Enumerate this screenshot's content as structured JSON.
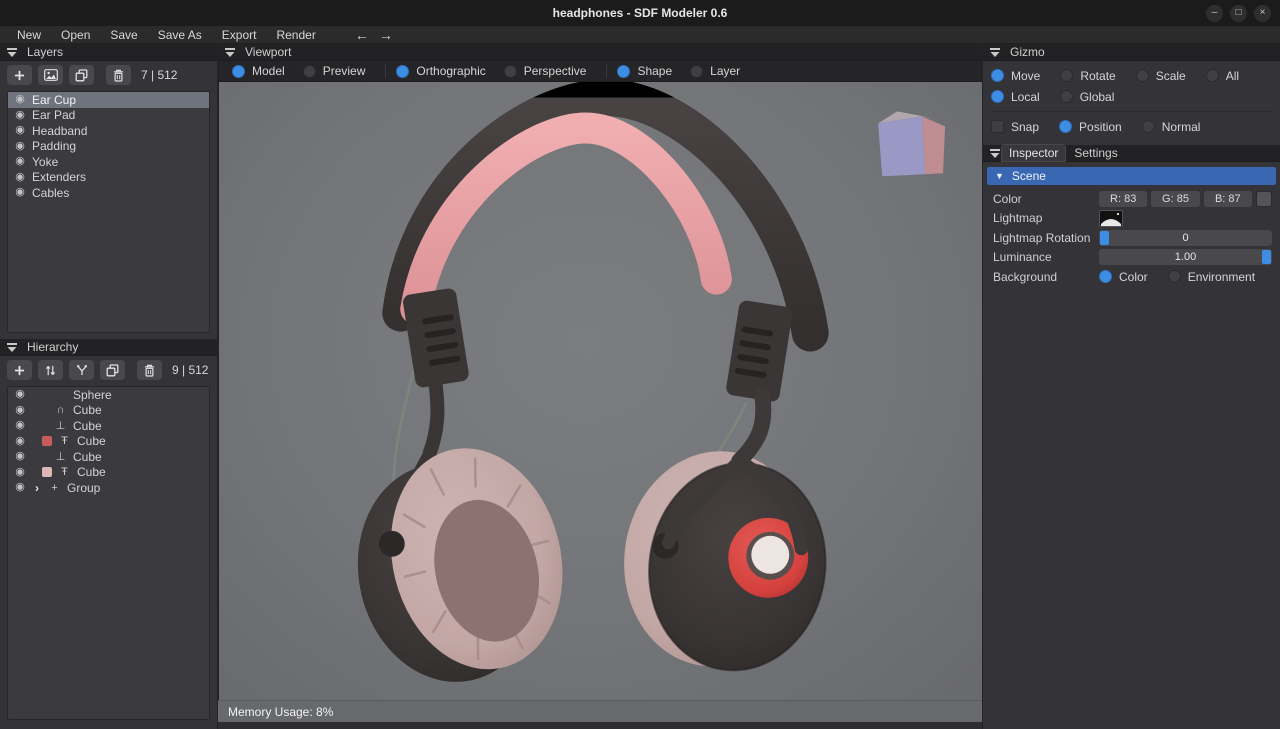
{
  "window": {
    "title": "headphones - SDF Modeler 0.6",
    "controls": {
      "minimize": "–",
      "maximize": "□",
      "close": "×"
    }
  },
  "menu": {
    "items": [
      "New",
      "Open",
      "Save",
      "Save As",
      "Export",
      "Render"
    ],
    "back": "←",
    "forward": "→"
  },
  "icons": {
    "eye": "◉",
    "chevron_right": "›",
    "scene_triangle": "▼"
  },
  "layers": {
    "title": "Layers",
    "count": "7 | 512",
    "items": [
      {
        "label": "Ear Cup",
        "selected": true
      },
      {
        "label": "Ear Pad",
        "selected": false
      },
      {
        "label": "Headband",
        "selected": false
      },
      {
        "label": "Padding",
        "selected": false
      },
      {
        "label": "Yoke",
        "selected": false
      },
      {
        "label": "Extenders",
        "selected": false
      },
      {
        "label": "Cables",
        "selected": false
      }
    ]
  },
  "hierarchy": {
    "title": "Hierarchy",
    "count": "9 | 512",
    "items": [
      {
        "label": "Sphere",
        "op": ""
      },
      {
        "label": "Cube",
        "op": "∩"
      },
      {
        "label": "Cube",
        "op": "⊥"
      },
      {
        "label": "Cube",
        "op": "Ŧ",
        "swatch": "#c65b5b"
      },
      {
        "label": "Cube",
        "op": "⊥"
      },
      {
        "label": "Cube",
        "op": "Ŧ",
        "swatch": "#dcb8b6"
      },
      {
        "label": "Group",
        "op": "+",
        "expandable": true
      }
    ]
  },
  "viewport": {
    "title": "Viewport",
    "toggles": [
      {
        "label": "Model",
        "on": true
      },
      {
        "label": "Preview",
        "on": false
      },
      {
        "label": "Orthographic",
        "on": true
      },
      {
        "label": "Perspective",
        "on": false
      },
      {
        "label": "Shape",
        "on": true
      },
      {
        "label": "Layer",
        "on": false
      }
    ],
    "memory_usage": "Memory Usage: 8%"
  },
  "gizmo": {
    "title": "Gizmo",
    "mode": [
      {
        "label": "Move",
        "on": true
      },
      {
        "label": "Rotate",
        "on": false
      },
      {
        "label": "Scale",
        "on": false
      },
      {
        "label": "All",
        "on": false
      }
    ],
    "space": [
      {
        "label": "Local",
        "on": true
      },
      {
        "label": "Global",
        "on": false
      }
    ],
    "snap": {
      "label": "Snap",
      "on": false
    },
    "snap_mode": [
      {
        "label": "Position",
        "on": true
      },
      {
        "label": "Normal",
        "on": false
      }
    ]
  },
  "inspector": {
    "tabs": [
      {
        "label": "Inspector",
        "active": true
      },
      {
        "label": "Settings",
        "active": false
      }
    ],
    "scene": {
      "title": "Scene",
      "color": {
        "label": "Color",
        "r": "R: 83",
        "g": "G: 85",
        "b": "B: 87",
        "swatch": "#535557"
      },
      "lightmap": {
        "label": "Lightmap"
      },
      "lightmap_rotation": {
        "label": "Lightmap Rotation",
        "value": "0"
      },
      "luminance": {
        "label": "Luminance",
        "value": "1.00"
      },
      "background": {
        "label": "Background",
        "options": [
          {
            "label": "Color",
            "on": true
          },
          {
            "label": "Environment",
            "on": false
          }
        ]
      }
    }
  },
  "colors": {
    "accent_blue": "#3d8de5",
    "scene_header_blue": "#3a67b2",
    "viewport_gray": "#747679",
    "headband_dark": "#3e3939",
    "padding_pink": "#e7a0a3",
    "earpad_mauve": "#c4a9a7",
    "ring_red": "#d6413e",
    "driver_cream": "#ece5e1"
  }
}
